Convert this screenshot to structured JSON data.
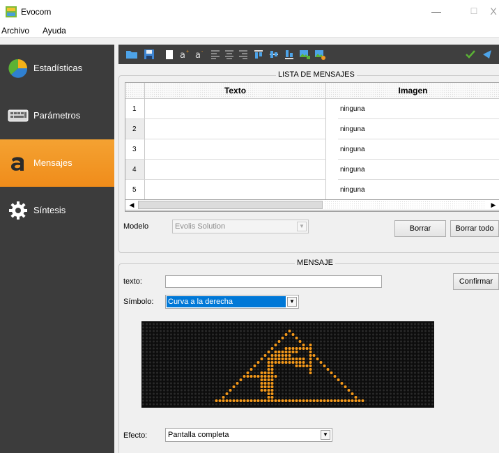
{
  "window": {
    "title": "Evocom",
    "minimize": "—",
    "maximize": "☐",
    "close": "X"
  },
  "menu": {
    "items": [
      {
        "label": "Archivo"
      },
      {
        "label": "Ayuda"
      }
    ]
  },
  "sidebar": {
    "items": [
      {
        "label": "Estadísticas",
        "icon": "statistics-icon"
      },
      {
        "label": "Parámetros",
        "icon": "keyboard-icon"
      },
      {
        "label": "Mensajes",
        "icon": "letter-a-icon",
        "active": true
      },
      {
        "label": "Síntesis",
        "icon": "gear-icon"
      }
    ]
  },
  "colors": {
    "sidebar_bg": "#3c3c3c",
    "active_accent": "#f39a22",
    "led_on": "#f59a1c",
    "led_off": "#2a2a2a",
    "selection": "#0078d7"
  },
  "list_group": {
    "title": "LISTA DE MENSAJES",
    "columns": [
      "Texto",
      "Imagen"
    ],
    "rows": [
      {
        "num": "1",
        "texto": "",
        "imagen": "ninguna"
      },
      {
        "num": "2",
        "texto": "",
        "imagen": "ninguna"
      },
      {
        "num": "3",
        "texto": "",
        "imagen": "ninguna"
      },
      {
        "num": "4",
        "texto": "",
        "imagen": "ninguna"
      },
      {
        "num": "5",
        "texto": "",
        "imagen": "ninguna"
      }
    ],
    "modelo_label": "Modelo",
    "modelo_value": "Evolis Solution",
    "borrar": "Borrar",
    "borrar_todo": "Borrar todo"
  },
  "message_group": {
    "title": "MENSAJE",
    "texto_label": "texto:",
    "texto_value": "",
    "confirmar": "Confirmar",
    "simbolo_label": "Símbolo:",
    "simbolo_value": "Curva a la derecha",
    "efecto_label": "Efecto:",
    "efecto_value": "Pantalla completa"
  }
}
